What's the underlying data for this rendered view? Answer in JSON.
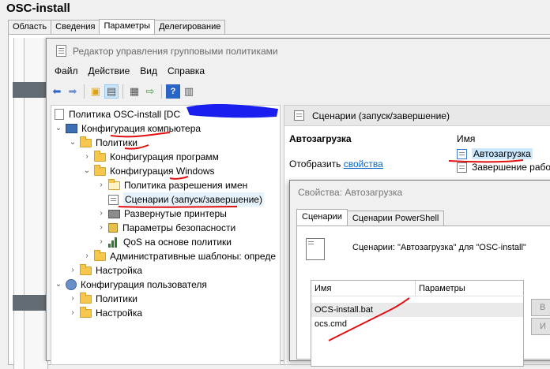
{
  "outer": {
    "title": "OSC-install",
    "tabs": [
      "Область",
      "Сведения",
      "Параметры",
      "Делегирование"
    ],
    "active_tab": 2
  },
  "gpe": {
    "title": "Редактор управления групповыми политиками",
    "menu": [
      "Файл",
      "Действие",
      "Вид",
      "Справка"
    ]
  },
  "tree": {
    "root": "Политика OSC-install [DC",
    "comp_config": "Конфигурация компьютера",
    "policies": "Политики",
    "prog_config": "Конфигурация программ",
    "win_config": "Конфигурация Windows",
    "name_policy": "Политика разрешения имен",
    "scripts": "Сценарии (запуск/завершение)",
    "printers": "Развернутые принтеры",
    "security": "Параметры безопасности",
    "qos": "QoS на основе политики",
    "admin_templates": "Административные шаблоны: опреде",
    "settings": "Настройка",
    "user_config": "Конфигурация пользователя",
    "user_policies": "Политики",
    "user_settings": "Настройка"
  },
  "right": {
    "header": "Сценарии (запуск/завершение)",
    "section": "Автозагрузка",
    "show_prefix": "Отобразить ",
    "show_link": "свойства",
    "col_name": "Имя",
    "item1": "Автозагрузка",
    "item2": "Завершение работ"
  },
  "dialog": {
    "title": "Свойства: Автозагрузка",
    "tabs": [
      "Сценарии",
      "Сценарии PowerShell"
    ],
    "desc": "Сценарии: \"Автозагрузка\" для \"OSC-install\"",
    "col_name": "Имя",
    "col_params": "Параметры",
    "rows": [
      "OCS-install.bat",
      "ocs.cmd"
    ],
    "side_buttons": [
      "В",
      "И"
    ]
  }
}
